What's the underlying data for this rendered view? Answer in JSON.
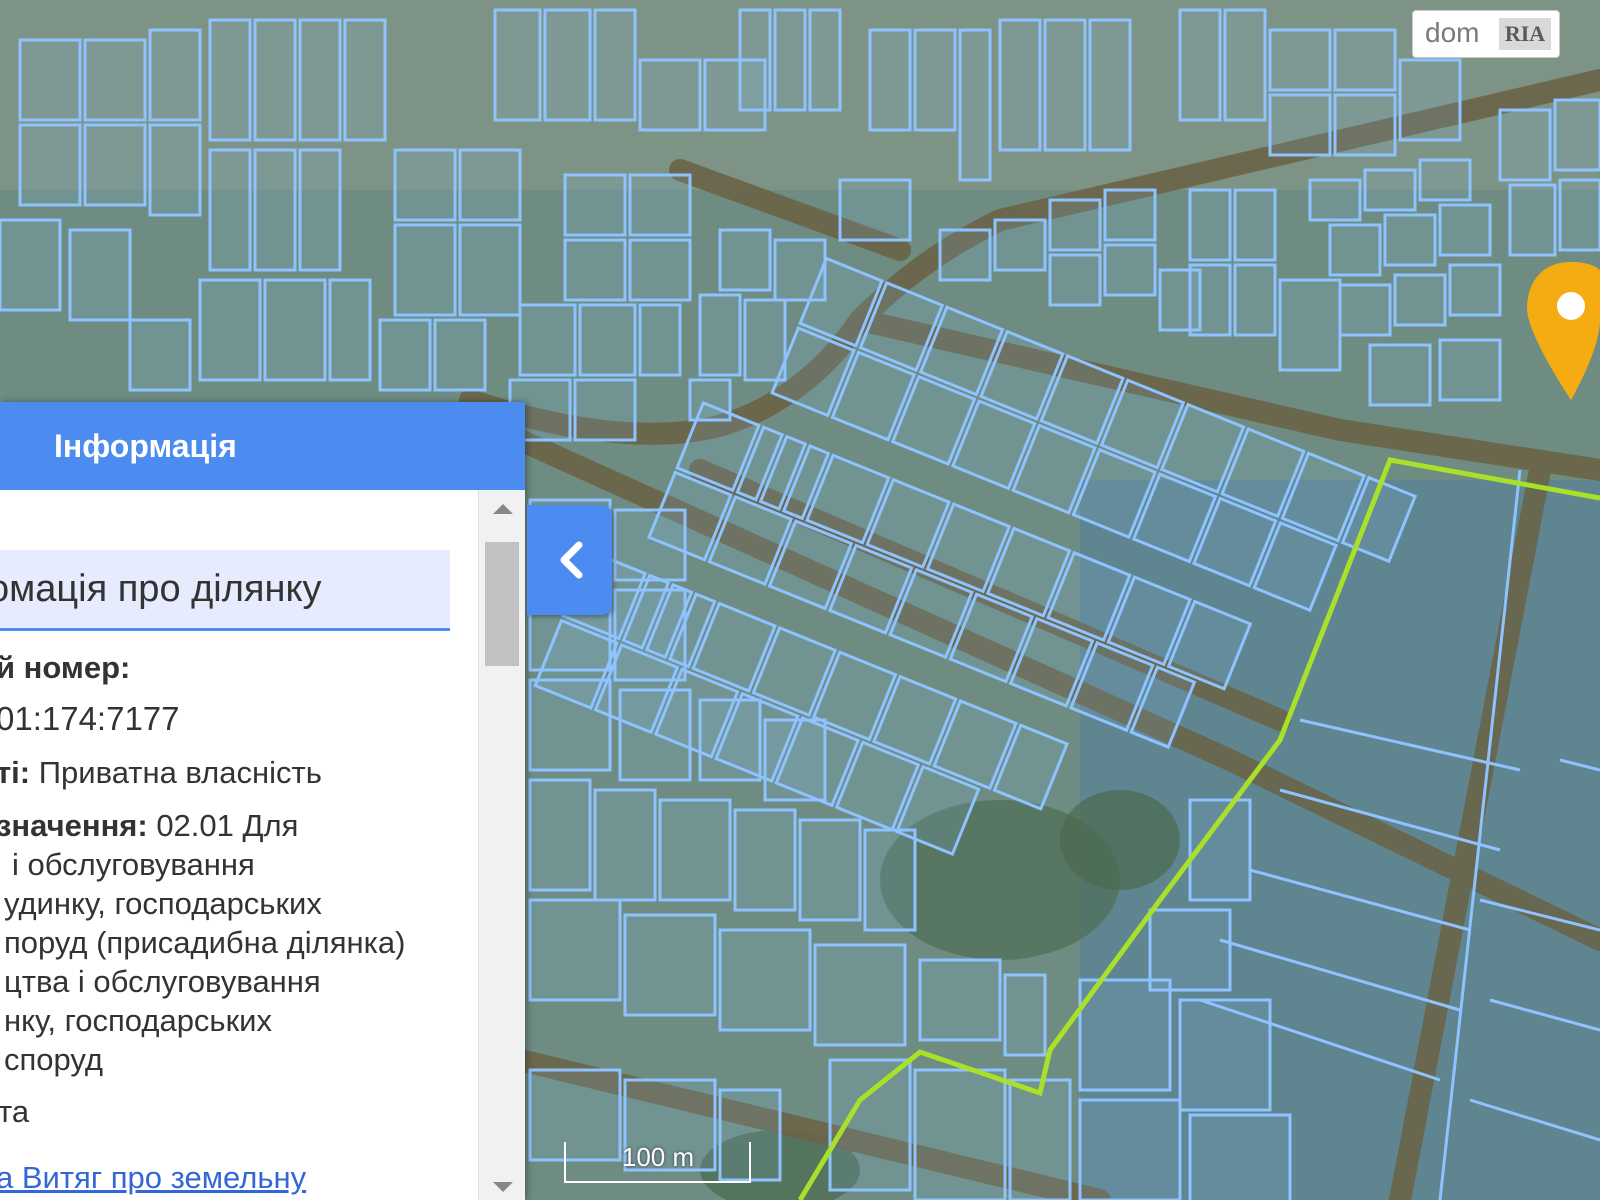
{
  "panel": {
    "title": "Інформація",
    "section_title": "омація про ділянку",
    "cadastral_label": "й номер:",
    "cadastral_value": "01:174:7177",
    "ownership_label": "ті:",
    "ownership_value": " Приватна власність",
    "purpose_label": "значення:",
    "purpose_value_1": " 02.01 Для",
    "purpose_lines": [
      "і обслуговування",
      "удинку, господарських",
      "поруд (присадибна ділянка)",
      "цтва і обслуговування",
      "нку, господарських",
      "споруд"
    ],
    "unit_fragment": "та",
    "extract_link": "а Витяг про земельну"
  },
  "map": {
    "scale_label": "100 m",
    "marker_color": "#f4ac12",
    "parcel_outline_color": "#8ec3ff",
    "highlight_boundary_color": "#a8e02a"
  },
  "branding": {
    "logo_text": "dom",
    "logo_badge": "RIA"
  },
  "icons": {
    "collapse": "chevron-left-icon",
    "marker": "map-pin-icon"
  }
}
